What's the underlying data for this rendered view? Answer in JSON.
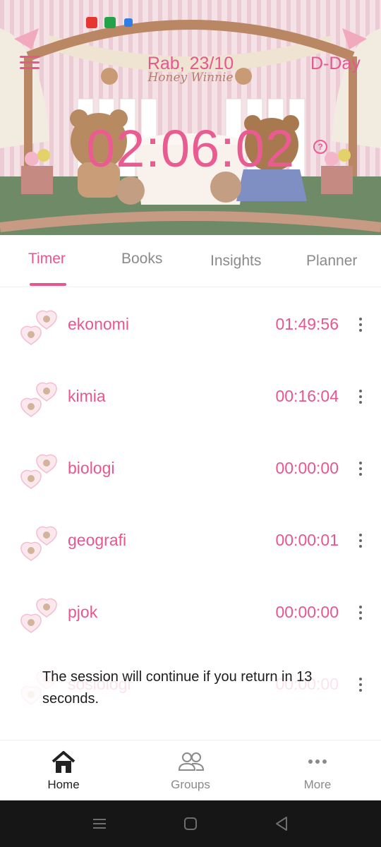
{
  "header": {
    "date": "Rab, 23/10",
    "dday_label": "D-Day",
    "timer": "02:06:02",
    "help_symbol": "?",
    "artwork_text": "Honey Winnie"
  },
  "tabs": [
    {
      "label": "Timer",
      "active": true
    },
    {
      "label": "Books",
      "active": false
    },
    {
      "label": "Insights",
      "active": false
    },
    {
      "label": "Planner",
      "active": false
    }
  ],
  "subjects": [
    {
      "name": "ekonomi",
      "time": "01:49:56",
      "icon": "heart-bear-icon"
    },
    {
      "name": "kimia",
      "time": "00:16:04",
      "icon": "heart-bear-icon"
    },
    {
      "name": "biologi",
      "time": "00:00:00",
      "icon": "heart-bear-icon"
    },
    {
      "name": "geografi",
      "time": "00:00:01",
      "icon": "heart-bear-icon"
    },
    {
      "name": "pjok",
      "time": "00:00:00",
      "icon": "heart-bear-icon"
    },
    {
      "name": "sosiologi",
      "time": "00:00:00",
      "icon": "heart-bear-icon"
    }
  ],
  "toast": {
    "message": "The session will continue if you return in 13 seconds."
  },
  "bottom_nav": [
    {
      "label": "Home",
      "icon": "home-icon",
      "active": true
    },
    {
      "label": "Groups",
      "icon": "groups-icon",
      "active": false
    },
    {
      "label": "More",
      "icon": "more-icon",
      "active": false
    }
  ],
  "system_nav": [
    "recent-apps-icon",
    "home-circle-icon",
    "back-icon"
  ],
  "colors": {
    "accent": "#e8568f",
    "inactive": "#8a8a8a",
    "system_bar": "#161616"
  }
}
